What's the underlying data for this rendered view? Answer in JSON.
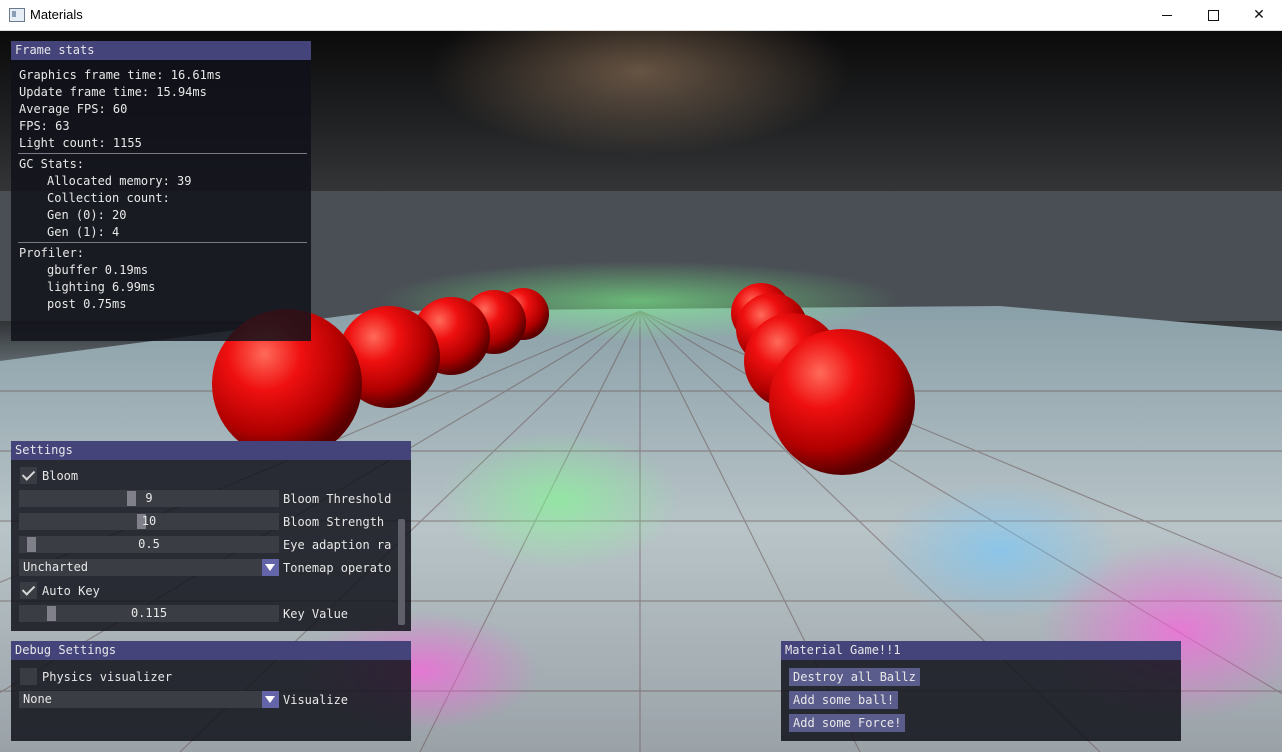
{
  "window": {
    "title": "Materials"
  },
  "frame_stats": {
    "title": "Frame stats",
    "graphics_frame_time": "Graphics frame time: 16.61ms",
    "update_frame_time": "Update frame time: 15.94ms",
    "average_fps": "Average FPS: 60",
    "fps": "FPS: 63",
    "light_count": "Light count: 1155",
    "gc_header": "GC Stats:",
    "allocated_memory": "Allocated memory: 39",
    "collection_count": "Collection count:",
    "gen0": "Gen (0): 20",
    "gen1": "Gen (1): 4",
    "profiler_header": "Profiler:",
    "gbuffer": "gbuffer 0.19ms",
    "lighting": "lighting 6.99ms",
    "post": "post 0.75ms"
  },
  "settings": {
    "title": "Settings",
    "bloom_label": "Bloom",
    "bloom_checked": true,
    "bloom_threshold": {
      "value": "9",
      "label": "Bloom Threshold",
      "fraction": 0.43
    },
    "bloom_strength": {
      "value": "10",
      "label": "Bloom Strength",
      "fraction": 0.47
    },
    "eye_adaptation": {
      "value": "0.5",
      "label": "Eye adaption ra",
      "fraction": 0.03
    },
    "tonemap": {
      "value": "Uncharted",
      "label": "Tonemap operator"
    },
    "auto_key_label": "Auto Key",
    "auto_key_checked": true,
    "key_value": {
      "value": "0.115",
      "label": "Key Value",
      "fraction": 0.11
    }
  },
  "debug_settings": {
    "title": "Debug Settings",
    "physics_label": "Physics visualizer",
    "physics_checked": false,
    "visualize": {
      "value": "None",
      "label": "Visualize"
    }
  },
  "material_game": {
    "title": "Material Game!!1",
    "destroy_label": "Destroy all Ballz",
    "add_ball_label": "Add some ball!",
    "add_force_label": "Add some Force!"
  },
  "colors": {
    "panel_title_bg": "#44447a",
    "button_bg": "#5a5c8c",
    "ball": "#e00000"
  }
}
